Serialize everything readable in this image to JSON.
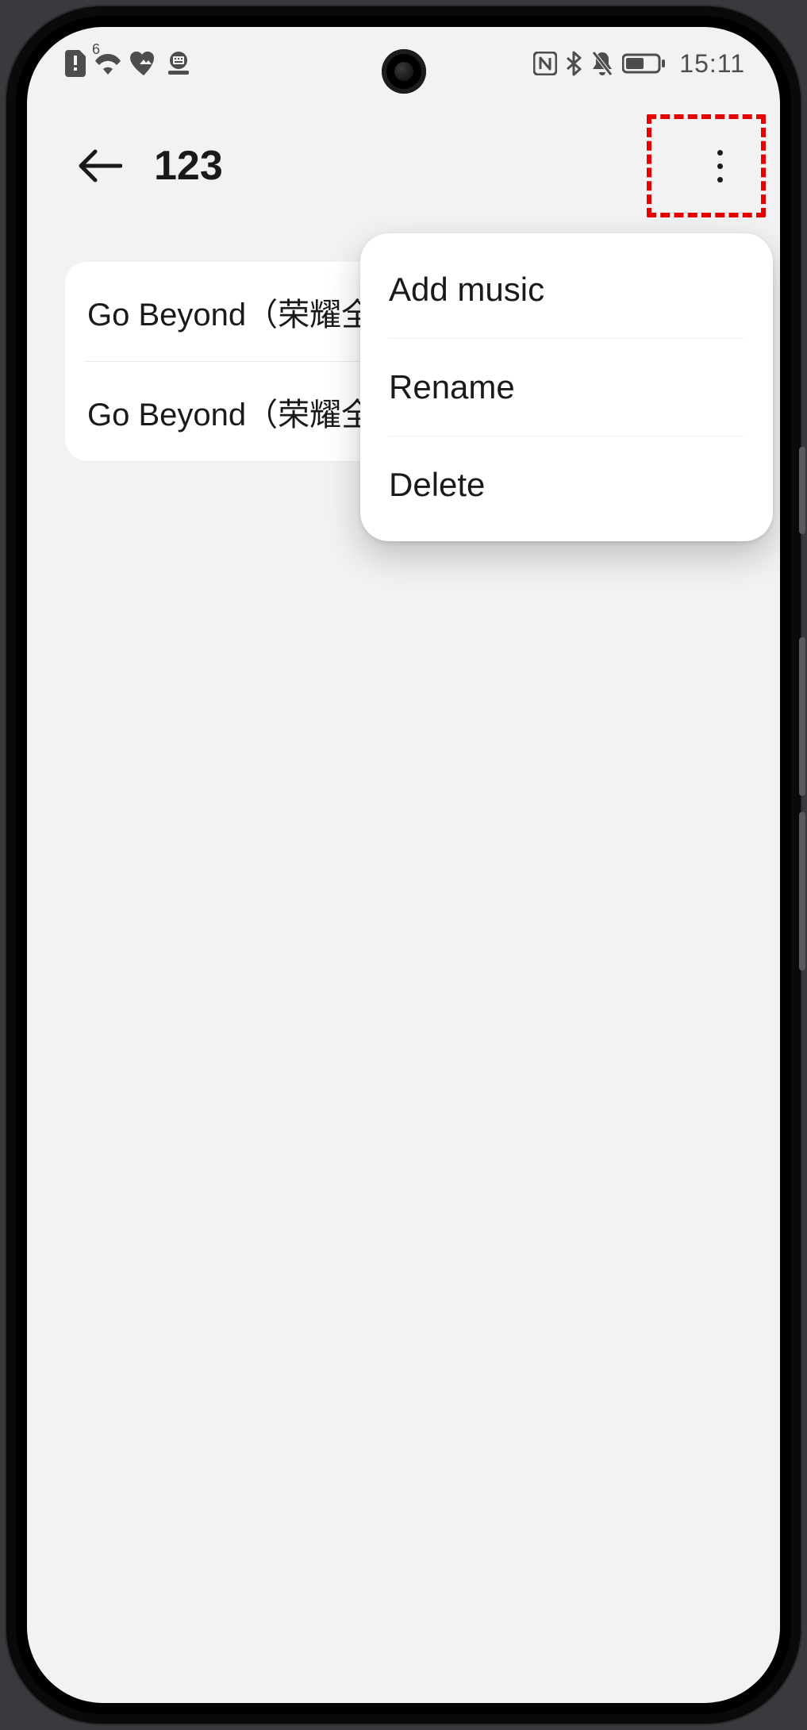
{
  "status": {
    "time": "15:11"
  },
  "header": {
    "title": "123"
  },
  "songs": [
    {
      "title": "Go Beyond（荣耀全"
    },
    {
      "title": "Go Beyond（荣耀全"
    }
  ],
  "menu": {
    "items": [
      {
        "label": "Add music"
      },
      {
        "label": "Rename"
      },
      {
        "label": "Delete"
      }
    ]
  }
}
